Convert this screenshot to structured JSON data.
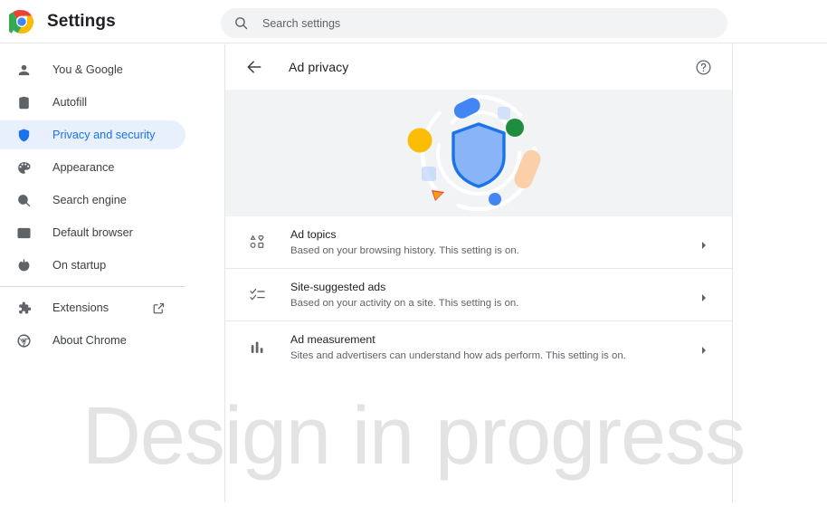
{
  "toolbar": {
    "app_title": "Settings",
    "logo_icon": "chrome-logo-icon",
    "search": {
      "icon": "search-icon",
      "placeholder": "Search settings",
      "value": ""
    }
  },
  "sidebar": {
    "items": [
      {
        "label": "You & Google",
        "icon": "person-icon",
        "selected": false
      },
      {
        "label": "Autofill",
        "icon": "clipboard-icon",
        "selected": false
      },
      {
        "label": "Privacy and security",
        "icon": "shield-icon",
        "selected": true
      },
      {
        "label": "Appearance",
        "icon": "palette-icon",
        "selected": false
      },
      {
        "label": "Search engine",
        "icon": "search-icon",
        "selected": false
      },
      {
        "label": "Default browser",
        "icon": "browser-window-icon",
        "selected": false
      },
      {
        "label": "On startup",
        "icon": "power-icon",
        "selected": false
      },
      {
        "label": "Extensions",
        "icon": "puzzle-piece-icon",
        "selected": false,
        "trailing_icon": "open-in-new-icon"
      },
      {
        "label": "About Chrome",
        "icon": "chrome-outline-icon",
        "selected": false
      }
    ],
    "divider_after_index": 6
  },
  "content": {
    "header": {
      "back_icon": "back-arrow-icon",
      "title": "Ad privacy",
      "help_icon": "help-circle-icon"
    },
    "hero": {
      "illustration": "ad-privacy-shield-illustration",
      "background": "#f1f3f4",
      "shield_fill": "#8ab4f8",
      "shield_stroke": "#1a73e8",
      "decorations": [
        {
          "name": "blue-pill",
          "color": "#4285f4"
        },
        {
          "name": "yellow-circle",
          "color": "#fbbc04"
        },
        {
          "name": "green-circle",
          "color": "#1e8e3e"
        },
        {
          "name": "peach-pill",
          "color": "#fbd0a8"
        },
        {
          "name": "blue-dot",
          "color": "#4285f4"
        },
        {
          "name": "red-triangle",
          "color": "#ea4335"
        },
        {
          "name": "dotted-square-left",
          "color": "#aecbfa"
        },
        {
          "name": "dotted-square-right",
          "color": "#aecbfa"
        }
      ]
    },
    "rows": [
      {
        "title": "Ad topics",
        "subtitle": "Based on your browsing history. This setting is on.",
        "icon": "ad-topics-shapes-icon",
        "chevron": "chevron-right-icon"
      },
      {
        "title": "Site-suggested ads",
        "subtitle": "Based on your activity on a site. This setting is on.",
        "icon": "checklist-icon",
        "chevron": "chevron-right-icon"
      },
      {
        "title": "Ad measurement",
        "subtitle": "Sites and advertisers can understand how ads perform. This setting is on.",
        "icon": "bar-chart-icon",
        "chevron": "chevron-right-icon"
      }
    ]
  },
  "watermark": {
    "text": "Design in progress",
    "color": "#e3e3e3"
  },
  "colors": {
    "accent": "#1a73e8",
    "selected_bg": "#e8f0fe",
    "text_primary": "#202124",
    "text_secondary": "#5f6368",
    "hero_bg": "#f1f3f4",
    "border": "#e7e8e9"
  }
}
